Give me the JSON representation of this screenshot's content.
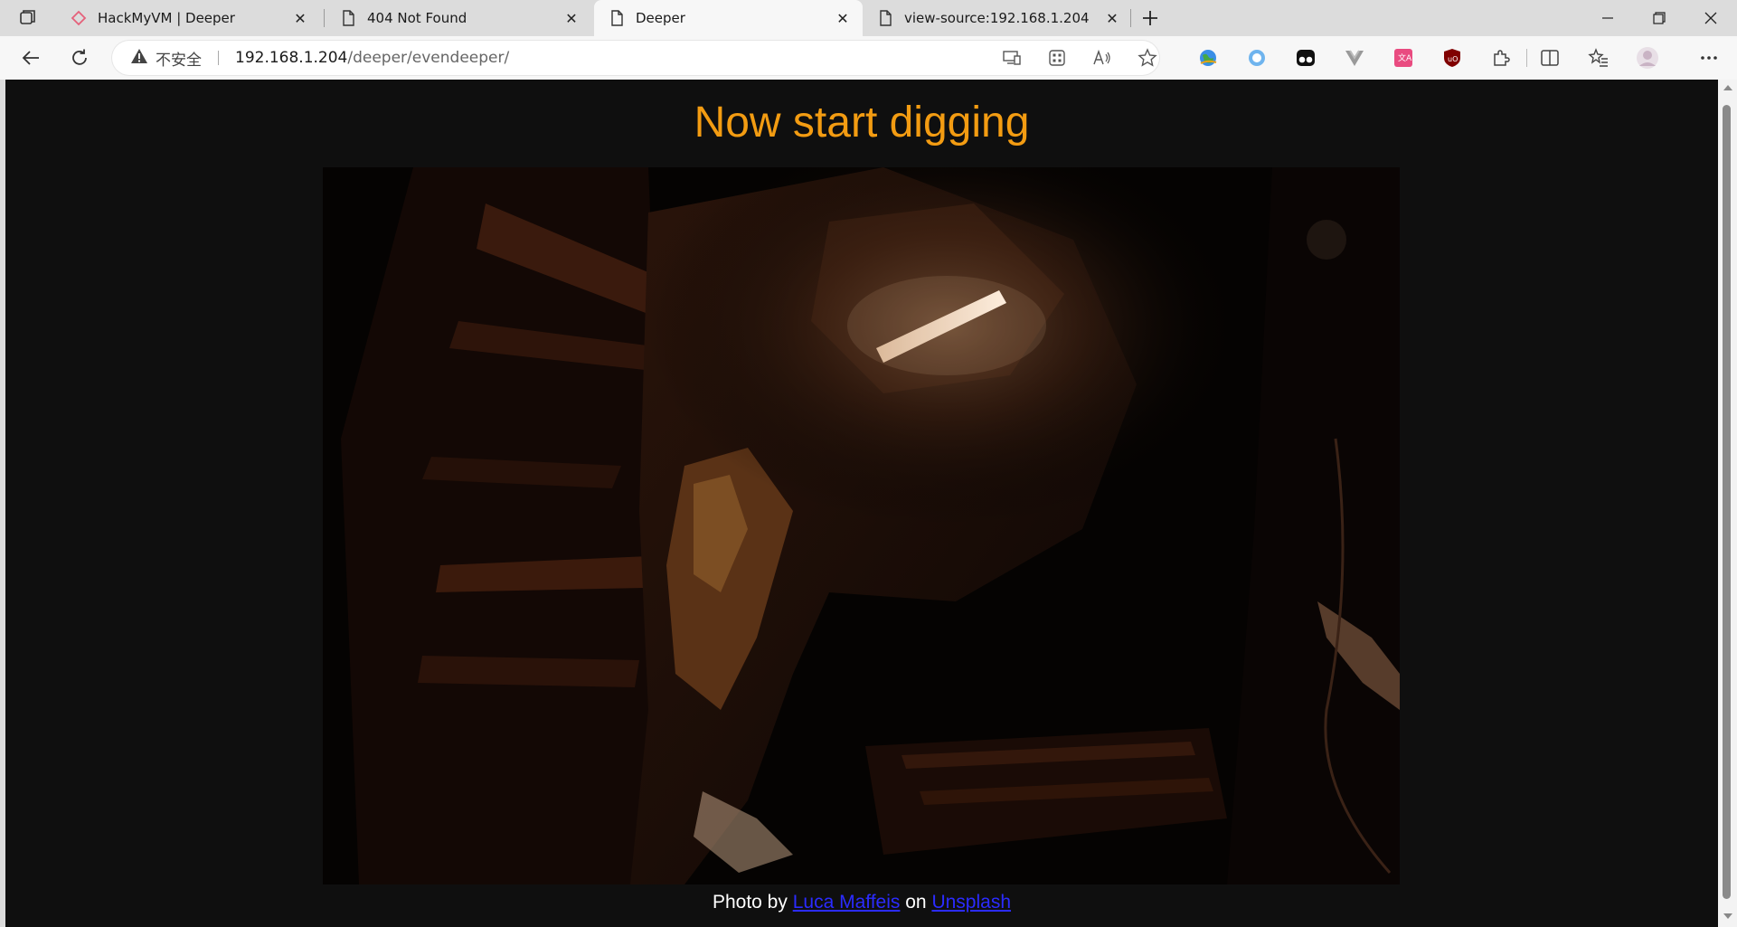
{
  "tabs": [
    {
      "title": "HackMyVM | Deeper",
      "favicon": "hackmyvm-diamond-icon"
    },
    {
      "title": "404 Not Found",
      "favicon": "document-icon"
    },
    {
      "title": "Deeper",
      "favicon": "document-icon",
      "active": true
    },
    {
      "title": "view-source:192.168.1.204",
      "favicon": "document-icon"
    }
  ],
  "addressbar": {
    "security_label": "不安全",
    "host": "192.168.1.204",
    "path": "/deeper/evendeeper/"
  },
  "page": {
    "title": "Now start digging",
    "title_color": "#f39c12",
    "background": "#0f0f0f",
    "image_alt": "dark mine tunnel with a fluorescent lamp",
    "caption": {
      "prefix": "Photo by",
      "author": "Luca Maffeis",
      "middle": "on",
      "site": "Unsplash"
    }
  },
  "colors": {
    "link": "#2b2bff",
    "tab_strip": "#dcdcdc",
    "toolbar": "#f7f7f7"
  }
}
